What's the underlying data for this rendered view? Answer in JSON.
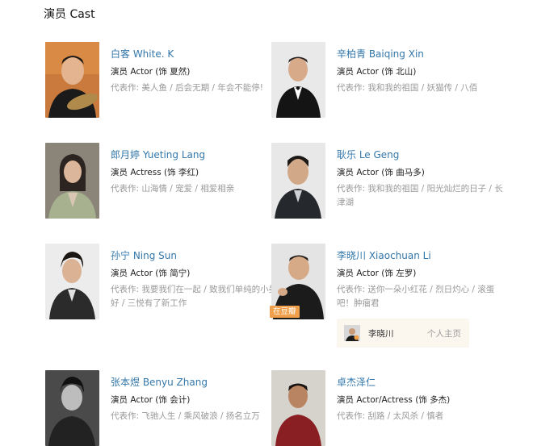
{
  "section": {
    "title": "演员 Cast"
  },
  "cast": [
    {
      "name": "白客 White. K",
      "role": "演员 Actor (饰 夏然)",
      "works": "代表作:  美人鱼 / 后会无期 / 年会不能停!"
    },
    {
      "name": "辛柏青 Baiqing Xin",
      "role": "演员 Actor (饰 北山)",
      "works": "代表作:  我和我的祖国 / 妖猫传 / 八佰"
    },
    {
      "name": "郎月婷 Yueting Lang",
      "role": "演员 Actress (饰 李红)",
      "works": "代表作:  山海情 / 宠爱 / 相爱相亲"
    },
    {
      "name": "耿乐 Le Geng",
      "role": "演员 Actor (饰 曲马多)",
      "works": "代表作:  我和我的祖国 / 阳光灿烂的日子 / 长津湖"
    },
    {
      "name": "孙宁 Ning Sun",
      "role": "演员 Actor (饰 简宁)",
      "works": "代表作:  我要我们在一起 / 致我们单纯的小美好 / 三悦有了新工作"
    },
    {
      "name": "李晓川 Xiaochuan Li",
      "role": "演员 Actor (饰 左罗)",
      "works": "代表作:  送你一朵小红花 / 烈日灼心 / 滚蛋吧！肿瘤君",
      "badge": "在豆瓣"
    },
    {
      "name": "张本煜 Benyu Zhang",
      "role": "演员 Actor (饰 会计)",
      "works": "代表作:  飞驰人生 / 乘风破浪 / 扬名立万"
    },
    {
      "name": "卓杰泽仁",
      "role": "演员 Actor/Actress (饰 多杰)",
      "works": "代表作:  刮路 / 太风杀 / 慎者"
    }
  ],
  "popup": {
    "name": "李晓川",
    "link": "个人主页"
  }
}
